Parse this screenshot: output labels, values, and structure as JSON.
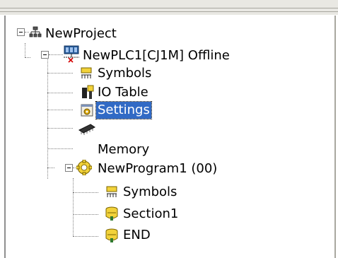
{
  "tree": {
    "project": {
      "label": "NewProject",
      "icon": "project-network-icon"
    },
    "plc": {
      "label": "NewPLC1[CJ1M] Offline",
      "icon": "plc-offline-icon"
    },
    "symbols": {
      "label": "Symbols",
      "icon": "symbols-icon"
    },
    "io_table": {
      "label": "IO Table",
      "icon": "io-table-icon"
    },
    "settings": {
      "label": "Settings",
      "icon": "settings-icon",
      "selected": true
    },
    "memory": {
      "label": "Memory",
      "icon": "memory-chip-icon"
    },
    "program": {
      "label": "NewProgram1 (00)",
      "icon": "program-icon"
    },
    "program_symbols": {
      "label": "Symbols",
      "icon": "symbols-icon"
    },
    "section1": {
      "label": "Section1",
      "icon": "section-icon"
    },
    "end": {
      "label": "END",
      "icon": "section-icon"
    }
  },
  "colors": {
    "selection": "#316ac5",
    "tree_lines": "#808080"
  }
}
